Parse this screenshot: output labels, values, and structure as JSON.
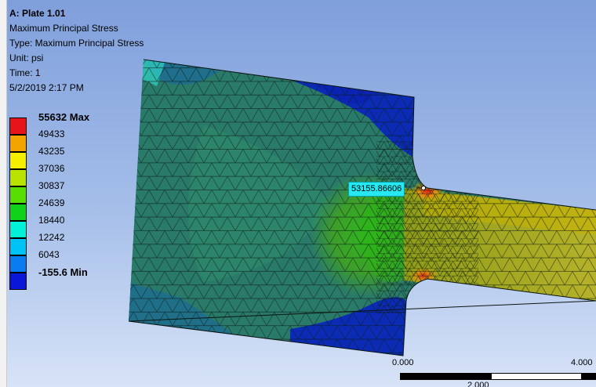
{
  "info": {
    "title": "A: Plate 1.01",
    "result_name": "Maximum Principal Stress",
    "type_line": "Type: Maximum Principal Stress",
    "unit_line": "Unit: psi",
    "time_line": "Time: 1",
    "date_line": "5/2/2019 2:17 PM"
  },
  "legend": {
    "entries": [
      {
        "label": "55632 Max",
        "color": "#e8141b"
      },
      {
        "label": "49433",
        "color": "#f2a400"
      },
      {
        "label": "43235",
        "color": "#f4ee00"
      },
      {
        "label": "37036",
        "color": "#b9e300"
      },
      {
        "label": "30837",
        "color": "#58de00"
      },
      {
        "label": "24639",
        "color": "#0ed31a"
      },
      {
        "label": "18440",
        "color": "#00f0d8"
      },
      {
        "label": "12242",
        "color": "#00c3f5"
      },
      {
        "label": "6043",
        "color": "#0a7cf2"
      },
      {
        "label": "-155.6 Min",
        "color": "#0a16d8"
      }
    ]
  },
  "probe": {
    "value": "53155.86606"
  },
  "scale": {
    "start_label": "0.000",
    "mid_label": "2.000",
    "end_label": "4.000"
  }
}
